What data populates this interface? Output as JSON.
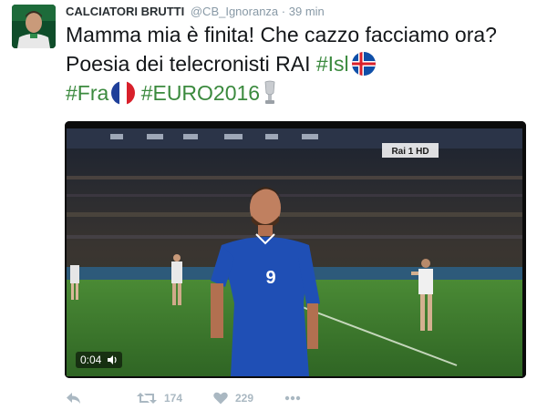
{
  "tweet": {
    "author_name": "CALCIATORI BRUTTI",
    "author_handle": "@CB_Ignoranza",
    "separator": "·",
    "timestamp": "39 min",
    "text_part1": "Mamma mia è finita! Che cazzo facciamo ora? Poesia dei telecronisti RAI ",
    "hashtag1": "#Isl",
    "hashtag2": "#Fra",
    "hashtag3": "#EURO2016",
    "icons": {
      "flag1": "iceland-flag-icon",
      "flag2": "france-flag-icon",
      "trophy": "trophy-icon"
    }
  },
  "media": {
    "duration": "0:04",
    "channel_logo": "Rai 1 HD",
    "player_number": "9"
  },
  "actions": {
    "reply_icon": "reply-icon",
    "retweet_count": "174",
    "like_count": "229",
    "more_icon": "more-icon"
  },
  "colors": {
    "hashtag": "#3b8a3e",
    "action_gray": "#aab8c2",
    "jersey_blue": "#1f4fb5",
    "pitch_green": "#3f7d30"
  }
}
